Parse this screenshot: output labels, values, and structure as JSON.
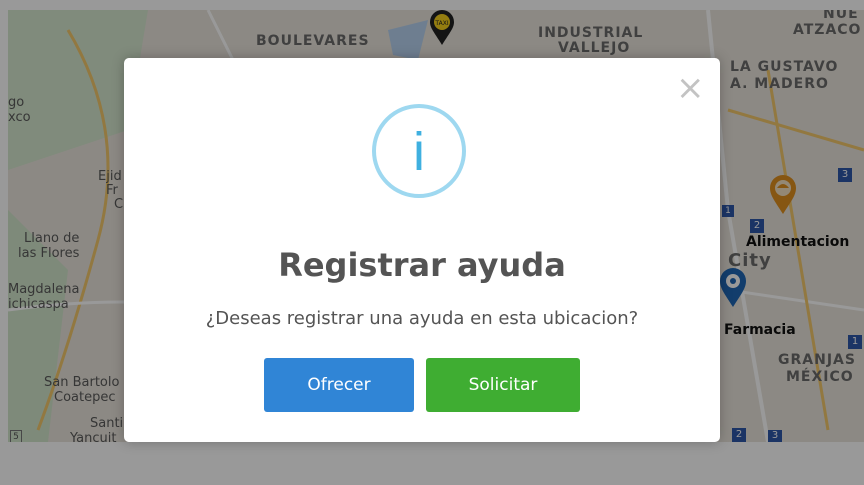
{
  "map": {
    "labels": {
      "boulevares": "BOULEVARES",
      "industrial": "INDUSTRIAL",
      "industrial_sub": "VALLEJO",
      "nue": "NUE",
      "atzaco": "ATZACO",
      "gustavo": "LA GUSTAVO",
      "madero": "A. MADERO",
      "go": "go",
      "xco": "xco",
      "ej": "Ejid",
      "fr": "Fr",
      "c": "C",
      "llano1": "Llano de",
      "llano2": "las Flores",
      "magdalena": "Magdalena",
      "chichicaspa": "ichicaspa",
      "san_bartolo": "San Bartolo",
      "coatepec": "Coatepec",
      "santi": "Santi",
      "yancuit": "Yancuit",
      "alimentacion": "Alimentacion",
      "city": "City",
      "farmacia": "Farmacia",
      "granjas": "GRANJAS",
      "mexico": "MÉXICO",
      "taxi": "TAXI",
      "route_badge_1": "3",
      "route_badge_2": "2",
      "route_badge_3": "1",
      "route_badge_4": "2",
      "route_badge_5": "1",
      "route_badge_6": "3",
      "route_badge_7": "5"
    }
  },
  "modal": {
    "icon": "info-icon",
    "icon_glyph": "i",
    "close_glyph": "×",
    "title": "Registrar ayuda",
    "text": "¿Deseas registrar una ayuda en esta ubicacion?",
    "buttons": {
      "offer": "Ofrecer",
      "request": "Solicitar"
    }
  },
  "colors": {
    "offer_button": "#3085d6",
    "request_button": "#3fad32",
    "info_ring": "#9ed8f0",
    "info_glyph": "#3fb0e0"
  }
}
